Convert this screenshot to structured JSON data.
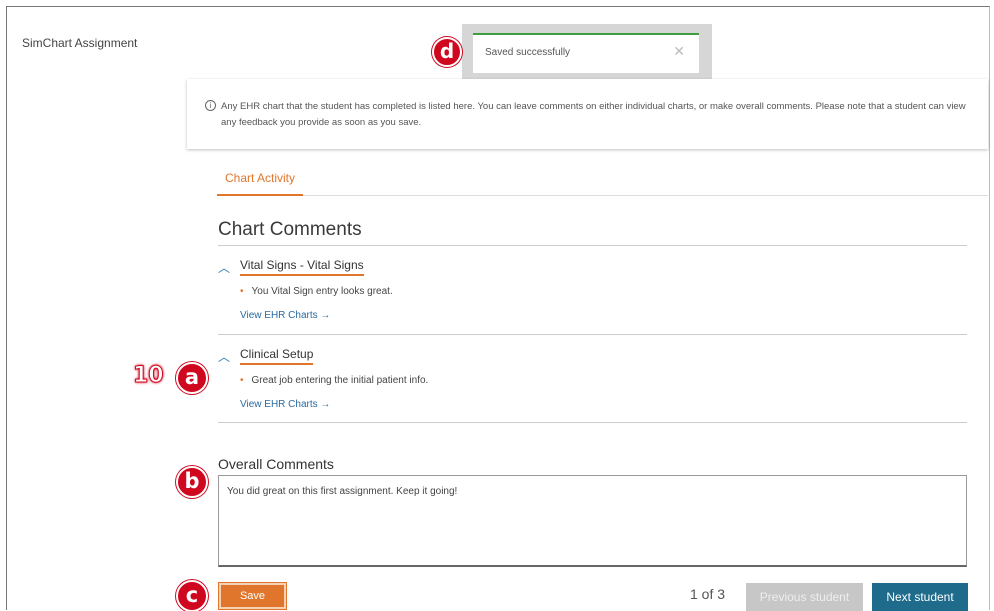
{
  "app": {
    "title": "SimChart Assignment"
  },
  "toast": {
    "message": "Saved successfully",
    "close_glyph": "✕"
  },
  "markers": {
    "d": "d",
    "a": "a",
    "b": "b",
    "c": "c",
    "step": "10"
  },
  "info": {
    "icon": "i",
    "text": "Any EHR chart that the student has completed is listed here. You can leave comments on either individual charts, or make overall comments. Please note that a student can view any feedback you provide as soon as you save."
  },
  "tabs": [
    {
      "label": "Chart Activity",
      "active": true
    }
  ],
  "chart_comments": {
    "title": "Chart Comments",
    "items": [
      {
        "name": "Vital Signs - Vital Signs",
        "comment": "You Vital Sign entry looks great.",
        "link": "View EHR Charts →"
      },
      {
        "name": "Clinical Setup",
        "comment": "Great job entering the initial patient info.",
        "link": "View EHR Charts →"
      }
    ]
  },
  "overall": {
    "label": "Overall Comments",
    "value": "You did great on this first assignment. Keep it going!"
  },
  "footer": {
    "save_label": "Save",
    "page_count": "1 of 3",
    "prev_label": "Previous student",
    "next_label": "Next student"
  },
  "colors": {
    "accent": "#e0762c",
    "primary": "#1e6b8c",
    "marker": "#d0081f",
    "success": "#3f9c3f"
  }
}
